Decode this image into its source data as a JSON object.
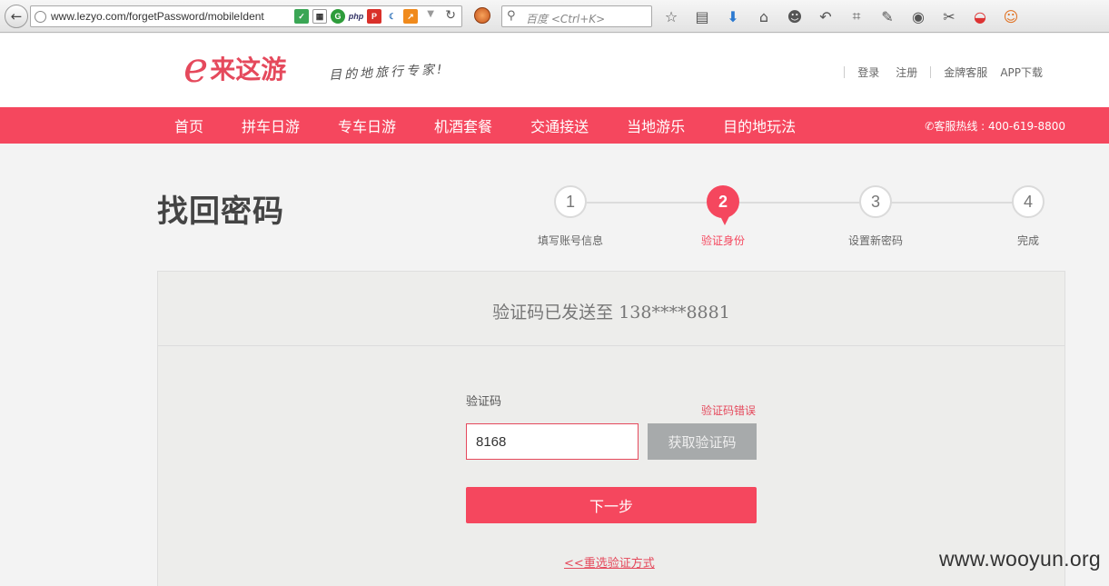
{
  "browser": {
    "url": "www.lezyo.com/forgetPassword/mobileIdent",
    "search_placeholder": "百度 <Ctrl+K>"
  },
  "site": {
    "logo_letter": "e",
    "logo_text": "来这游",
    "slogan": "目的地旅行专家!",
    "top_links": {
      "login": "登录",
      "register": "注册",
      "vip_service": "金牌客服",
      "app_download": "APP下载"
    },
    "nav": [
      "首页",
      "拼车日游",
      "专车日游",
      "机酒套餐",
      "交通接送",
      "当地游乐",
      "目的地玩法"
    ],
    "hotline": "客服热线 : 400-619-8800"
  },
  "page": {
    "title": "找回密码",
    "steps": [
      {
        "number": "1",
        "label": "填写账号信息",
        "active": false
      },
      {
        "number": "2",
        "label": "验证身份",
        "active": true
      },
      {
        "number": "3",
        "label": "设置新密码",
        "active": false
      },
      {
        "number": "4",
        "label": "完成",
        "active": false
      }
    ],
    "sent_message": "验证码已发送至 138****8881",
    "code_label": "验证码",
    "code_error": "验证码错误",
    "code_value": "8168",
    "get_code_button": "获取验证码",
    "next_button": "下一步",
    "reselect_link": "<<重选验证方式"
  },
  "watermark": "www.wooyun.org",
  "colors": {
    "brand": "#f5475e",
    "disabled": "#a7aaab"
  }
}
